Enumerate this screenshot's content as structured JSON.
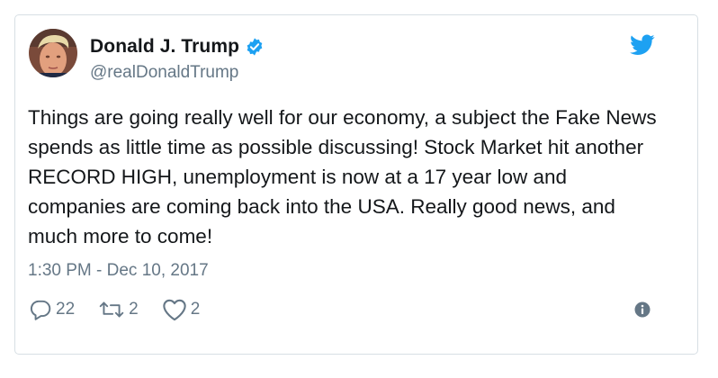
{
  "tweet": {
    "author": {
      "display_name": "Donald J. Trump",
      "handle": "@realDonaldTrump",
      "verified_icon": "verified-badge-icon",
      "avatar_icon": "profile-avatar"
    },
    "text": "Things are going really well for our economy, a subject the Fake News spends as little time as possible discussing! Stock Market hit another RECORD HIGH, unemployment is now at a 17 year low and companies are coming back into the USA. Really good news, and much more to come!",
    "timestamp": "1:30 PM - Dec 10, 2017",
    "actions": {
      "replies": "22",
      "retweets": "2",
      "likes": "2"
    },
    "icons": {
      "platform": "twitter-bird-icon",
      "reply": "reply-bubble-icon",
      "retweet": "retweet-arrows-icon",
      "like": "heart-icon",
      "info": "info-circle-icon"
    }
  },
  "colors": {
    "brand_blue": "#1da1f2",
    "text_primary": "#14171a",
    "text_secondary": "#657786",
    "border": "#d7dfe4"
  }
}
